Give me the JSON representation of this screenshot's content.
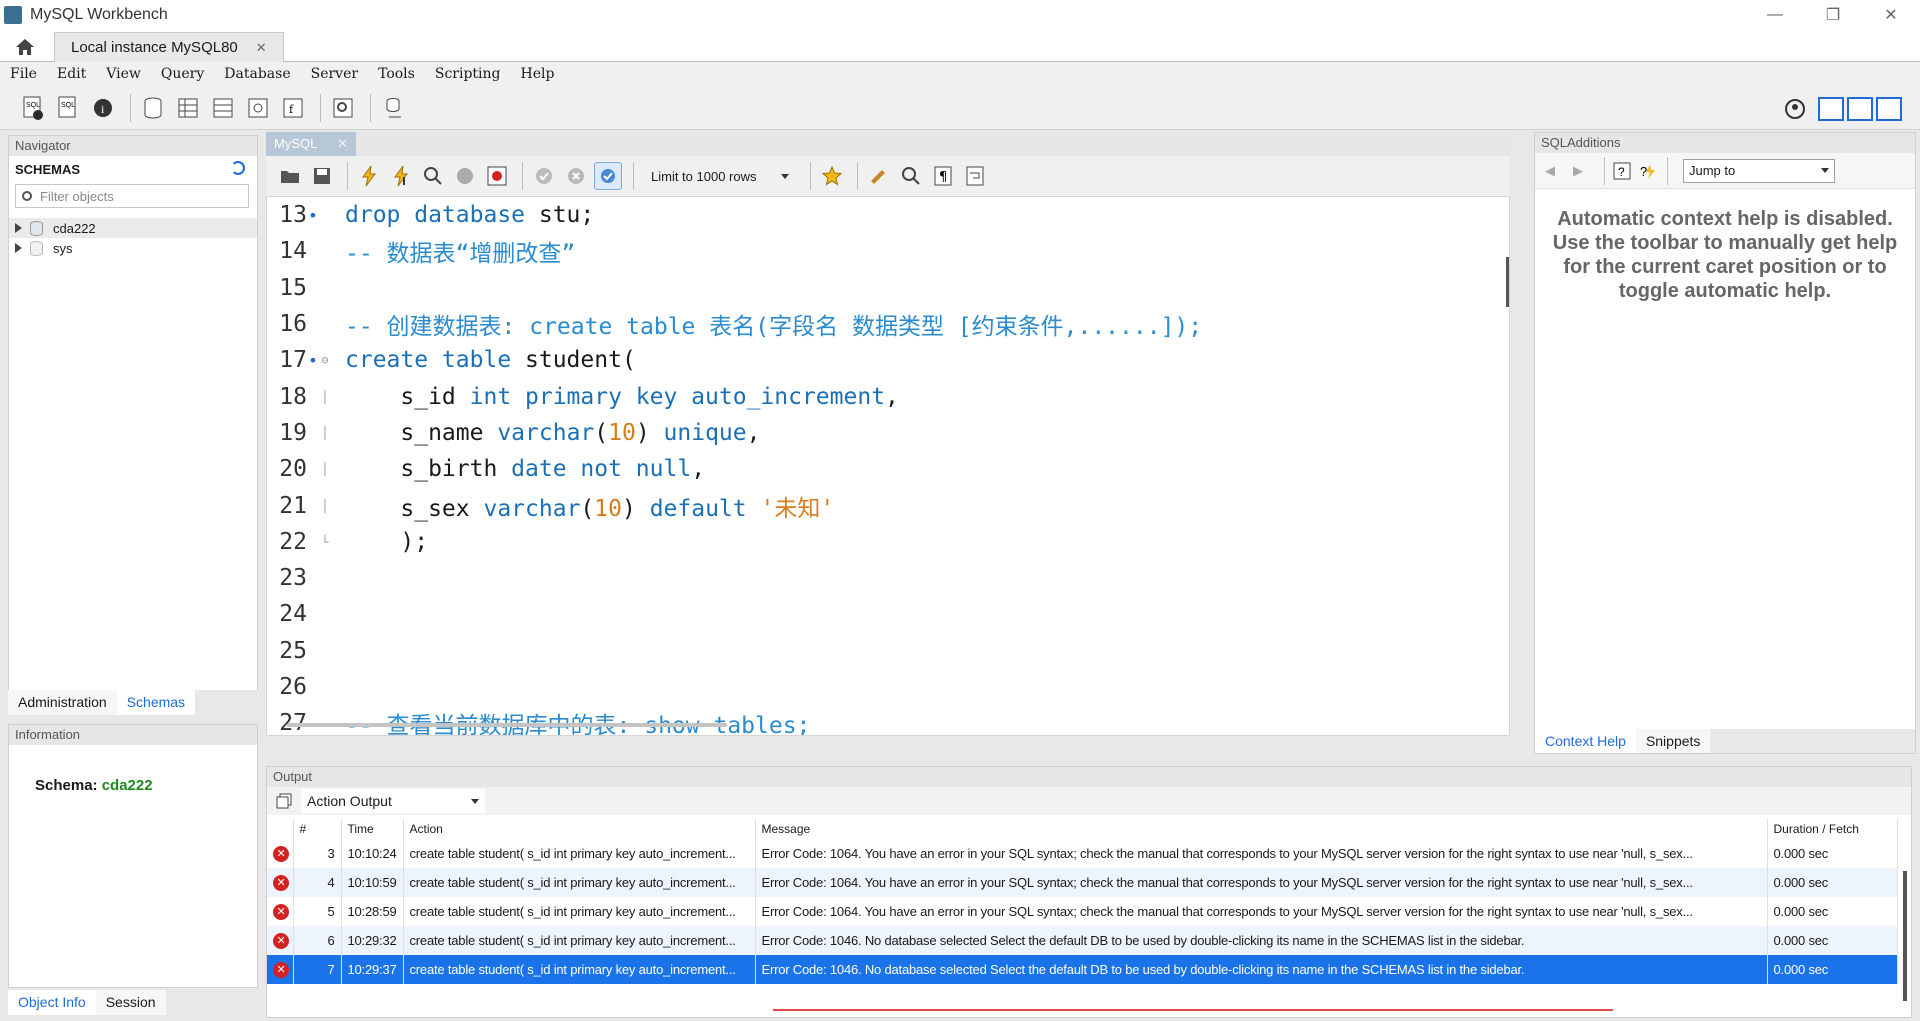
{
  "window": {
    "title": "MySQL Workbench",
    "controls": [
      "—",
      "❐",
      "✕"
    ]
  },
  "tabs": {
    "connection": "Local instance MySQL80",
    "close": "✕"
  },
  "menu": [
    "File",
    "Edit",
    "View",
    "Query",
    "Database",
    "Server",
    "Tools",
    "Scripting",
    "Help"
  ],
  "navigator": {
    "title": "Navigator",
    "schemas_title": "SCHEMAS",
    "filter_placeholder": "Filter objects",
    "schemas": [
      {
        "name": "cda222",
        "selected": true
      },
      {
        "name": "sys",
        "selected": false
      }
    ],
    "tabs": [
      "Administration",
      "Schemas"
    ]
  },
  "information": {
    "title": "Information",
    "schema_label": "Schema:",
    "schema_value": "cda222",
    "tabs": [
      "Object Info",
      "Session"
    ]
  },
  "editor": {
    "tab_label": "MySQL",
    "limit_label": "Limit to 1000 rows",
    "lines": [
      {
        "n": "13",
        "marker": "•",
        "fold": "",
        "html": "<span class='kw'>drop database</span> stu;"
      },
      {
        "n": "14",
        "marker": "",
        "fold": "",
        "html": "<span class='cm'>-- 数据表“增删改查”</span>"
      },
      {
        "n": "15",
        "marker": "",
        "fold": "",
        "html": ""
      },
      {
        "n": "16",
        "marker": "",
        "fold": "",
        "html": "<span class='cm'>-- 创建数据表: create table 表名(字段名 数据类型 [约束条件,......]);</span>"
      },
      {
        "n": "17",
        "marker": "•",
        "fold": "⊖",
        "html": "<span class='kw'>create table</span> student("
      },
      {
        "n": "18",
        "marker": "",
        "fold": "│",
        "html": "    s_id <span class='kw'>int primary key auto_increment</span>,"
      },
      {
        "n": "19",
        "marker": "",
        "fold": "│",
        "html": "    s_name <span class='kw'>varchar</span>(<span class='num'>10</span>) <span class='kw'>unique</span>,"
      },
      {
        "n": "20",
        "marker": "",
        "fold": "│",
        "html": "    s_birth <span class='kw'>date not null</span>,"
      },
      {
        "n": "21",
        "marker": "",
        "fold": "│",
        "html": "    s_sex <span class='kw'>varchar</span>(<span class='num'>10</span>) <span class='kw'>default</span> <span class='str'>'未知'</span>"
      },
      {
        "n": "22",
        "marker": "",
        "fold": "└",
        "html": "    );"
      },
      {
        "n": "23",
        "marker": "",
        "fold": "",
        "html": ""
      },
      {
        "n": "24",
        "marker": "",
        "fold": "",
        "html": ""
      },
      {
        "n": "25",
        "marker": "",
        "fold": "",
        "html": ""
      },
      {
        "n": "26",
        "marker": "",
        "fold": "",
        "html": ""
      },
      {
        "n": "27",
        "marker": "",
        "fold": "",
        "html": "<span class='cm'>-- 查看当前数据库中的表: show tables;</span>"
      }
    ]
  },
  "sqladditions": {
    "title": "SQLAdditions",
    "jump_label": "Jump to",
    "help_text": "Automatic context help is disabled. Use the toolbar to manually get help for the current caret position or to toggle automatic help.",
    "tabs": [
      "Context Help",
      "Snippets"
    ]
  },
  "output": {
    "title": "Output",
    "select_label": "Action Output",
    "columns": [
      "",
      "#",
      "Time",
      "Action",
      "Message",
      "Duration / Fetch"
    ],
    "rows": [
      {
        "n": "3",
        "time": "10:10:24",
        "action": "create table student( s_id int primary key auto_increment...",
        "message": "Error Code: 1064. You have an error in your SQL syntax; check the manual that corresponds to your MySQL server version for the right syntax to use near 'null,    s_sex...",
        "duration": "0.000 sec"
      },
      {
        "n": "4",
        "time": "10:10:59",
        "action": "create table student( s_id int primary key auto_increment...",
        "message": "Error Code: 1064. You have an error in your SQL syntax; check the manual that corresponds to your MySQL server version for the right syntax to use near 'null,    s_sex...",
        "duration": "0.000 sec"
      },
      {
        "n": "5",
        "time": "10:28:59",
        "action": "create table student( s_id int primary key auto_increment...",
        "message": "Error Code: 1064. You have an error in your SQL syntax; check the manual that corresponds to your MySQL server version for the right syntax to use near 'null,    s_sex...",
        "duration": "0.000 sec"
      },
      {
        "n": "6",
        "time": "10:29:32",
        "action": "create table student( s_id int primary key auto_increment...",
        "message": "Error Code: 1046. No database selected Select the default DB to be used by double-clicking its name in the SCHEMAS list in the sidebar.",
        "duration": "0.000 sec"
      },
      {
        "n": "7",
        "time": "10:29:37",
        "action": "create table student( s_id int primary key auto_increment...",
        "message": "Error Code: 1046. No database selected Select the default DB to be used by double-clicking its name in the SCHEMAS list in the sidebar.",
        "duration": "0.000 sec"
      }
    ],
    "selected_row": 4
  },
  "colors": {
    "accent": "#1a73e8",
    "keyword": "#1a6fb5",
    "comment": "#2a8bcf",
    "number": "#d77c1c",
    "error": "#d32222",
    "schema_green": "#1f8a1f"
  }
}
